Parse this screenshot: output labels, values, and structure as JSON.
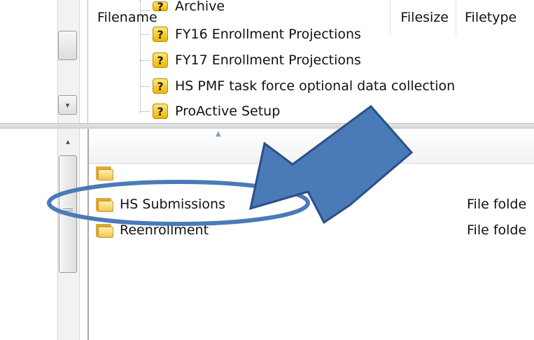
{
  "tree": {
    "items": [
      {
        "label": "Archive",
        "icon": "question-icon"
      },
      {
        "label": "FY16 Enrollment Projections",
        "icon": "question-icon"
      },
      {
        "label": "FY17 Enrollment Projections",
        "icon": "question-icon"
      },
      {
        "label": "HS PMF task force optional data collection",
        "icon": "question-icon"
      },
      {
        "label": "ProActive Setup",
        "icon": "question-icon"
      }
    ],
    "question_glyph": "?"
  },
  "file_list": {
    "columns": {
      "filename": "Filename",
      "filesize": "Filesize",
      "filetype": "Filetype"
    },
    "rows": [
      {
        "name": "",
        "type": "",
        "icon": "folder-icon"
      },
      {
        "name": "HS Submissions",
        "type": "File folde",
        "icon": "folder-icon"
      },
      {
        "name": "Reenrollment",
        "type": "File folde",
        "icon": "folder-icon"
      }
    ]
  },
  "scroll": {
    "down_glyph": "▾",
    "up_glyph": "▴",
    "sort_glyph": "▲"
  },
  "annotation": {
    "arrow_color": "#4a7ab8",
    "ellipse_color": "#4a7ab8"
  }
}
